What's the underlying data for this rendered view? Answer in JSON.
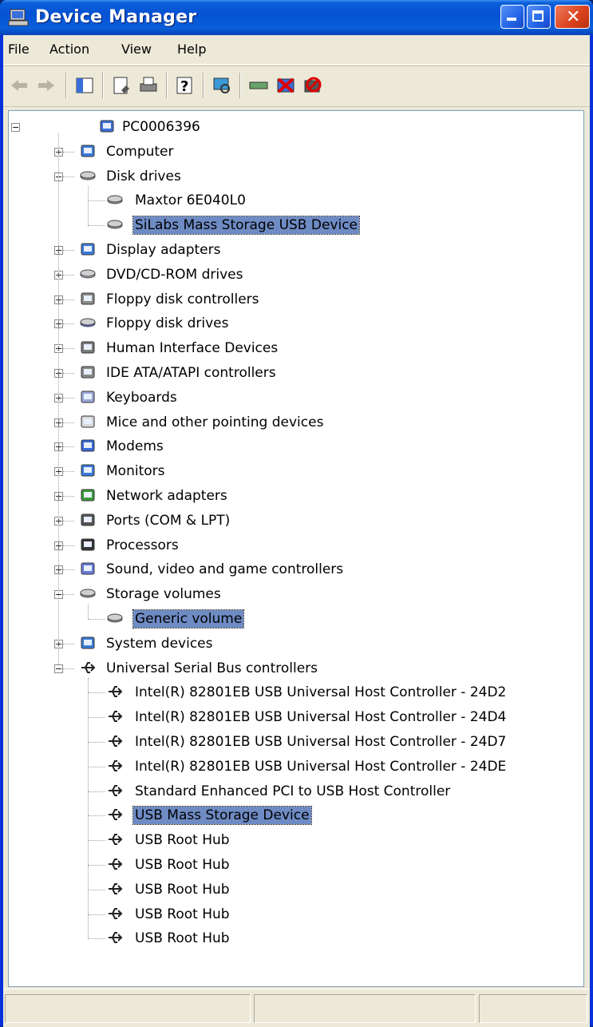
{
  "window": {
    "title": "Device Manager"
  },
  "menu": {
    "file": "File",
    "action": "Action",
    "view": "View",
    "help": "Help"
  },
  "toolbar": {
    "icons": [
      "back-arrow-icon",
      "forward-arrow-icon",
      "show-hide-console-tree-icon",
      "properties-icon",
      "print-icon",
      "help-icon",
      "scan-hardware-icon",
      "update-driver-icon",
      "uninstall-icon",
      "disable-icon"
    ]
  },
  "tree": {
    "root": "PC0006396",
    "categories": [
      {
        "label": "Computer",
        "icon": "computer-icon"
      },
      {
        "label": "Disk drives",
        "icon": "disk-drive-icon",
        "children": [
          {
            "label": "Maxtor 6E040L0"
          },
          {
            "label": "SiLabs Mass Storage USB Device",
            "selected": true
          }
        ]
      },
      {
        "label": "Display adapters",
        "icon": "display-adapter-icon"
      },
      {
        "label": "DVD/CD-ROM drives",
        "icon": "dvd-drive-icon"
      },
      {
        "label": "Floppy disk controllers",
        "icon": "floppy-controller-icon"
      },
      {
        "label": "Floppy disk drives",
        "icon": "floppy-drive-icon"
      },
      {
        "label": "Human Interface Devices",
        "icon": "hid-icon"
      },
      {
        "label": "IDE ATA/ATAPI controllers",
        "icon": "ide-controller-icon"
      },
      {
        "label": "Keyboards",
        "icon": "keyboard-icon"
      },
      {
        "label": "Mice and other pointing devices",
        "icon": "mouse-icon"
      },
      {
        "label": "Modems",
        "icon": "modem-icon"
      },
      {
        "label": "Monitors",
        "icon": "monitor-icon"
      },
      {
        "label": "Network adapters",
        "icon": "network-adapter-icon"
      },
      {
        "label": "Ports (COM & LPT)",
        "icon": "port-icon"
      },
      {
        "label": "Processors",
        "icon": "processor-icon"
      },
      {
        "label": "Sound, video and game controllers",
        "icon": "sound-icon"
      },
      {
        "label": "Storage volumes",
        "icon": "storage-volume-icon",
        "children": [
          {
            "label": "Generic volume",
            "selected": true
          }
        ]
      },
      {
        "label": "System devices",
        "icon": "system-device-icon"
      },
      {
        "label": "Universal Serial Bus controllers",
        "icon": "usb-icon",
        "children": [
          {
            "label": "Intel(R) 82801EB USB Universal Host Controller - 24D2"
          },
          {
            "label": "Intel(R) 82801EB USB Universal Host Controller - 24D4"
          },
          {
            "label": "Intel(R) 82801EB USB Universal Host Controller - 24D7"
          },
          {
            "label": "Intel(R) 82801EB USB Universal Host Controller - 24DE"
          },
          {
            "label": "Standard Enhanced PCI to USB Host Controller"
          },
          {
            "label": "USB Mass Storage Device",
            "selected": true
          },
          {
            "label": "USB Root Hub"
          },
          {
            "label": "USB Root Hub"
          },
          {
            "label": "USB Root Hub"
          },
          {
            "label": "USB Root Hub"
          },
          {
            "label": "USB Root Hub"
          }
        ]
      }
    ]
  },
  "colors": {
    "selection": "#6e8bc4",
    "titlebar": "#0652d6",
    "chrome": "#ece9d8"
  }
}
